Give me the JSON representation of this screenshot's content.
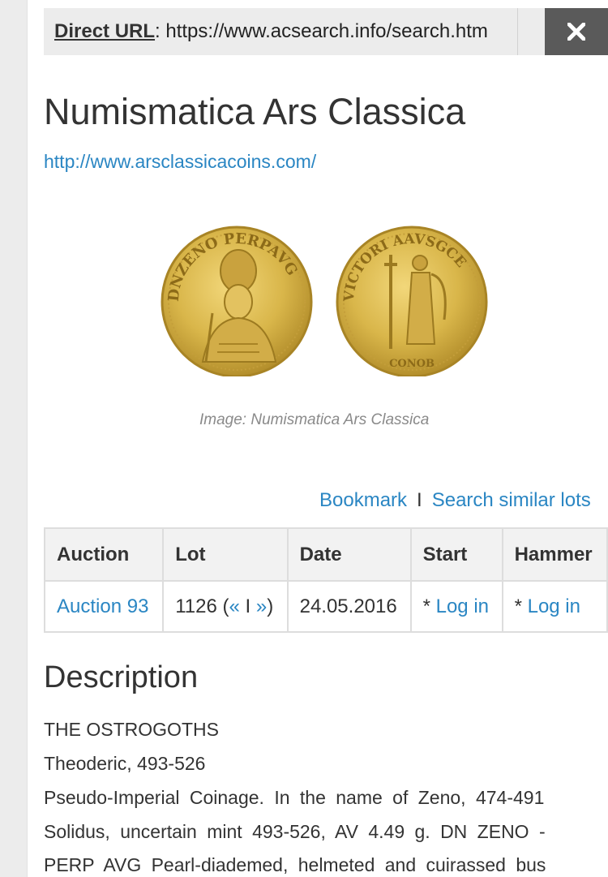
{
  "url_bar": {
    "label": "Direct URL",
    "separator": ":",
    "url": "https://www.acsearch.info/search.htm"
  },
  "close_icon": "close-icon",
  "house": {
    "title": "Numismatica Ars Classica",
    "website": "http://www.arsclassicacoins.com/"
  },
  "image": {
    "obverse_legend": "DNZENO PERPAVG",
    "reverse_legend": "VICTORI AAVSGCE",
    "exergue": "CONOB",
    "caption": "Image: Numismatica Ars Classica"
  },
  "actions": {
    "bookmark": "Bookmark",
    "divider": "I",
    "search_similar": "Search similar lots"
  },
  "table": {
    "headers": [
      "Auction",
      "Lot",
      "Date",
      "Start",
      "Hammer"
    ],
    "row": {
      "auction": "Auction 93",
      "lot_number": "1126",
      "lot_open": "(",
      "prev": "«",
      "nav_divider": "I",
      "next": "»",
      "lot_close": ")",
      "date": "24.05.2016",
      "start_prefix": "* ",
      "start_link": "Log in",
      "hammer_prefix": "* ",
      "hammer_link": "Log in"
    }
  },
  "description": {
    "heading": "Description",
    "lines": [
      "THE OSTROGOTHS",
      "Theoderic, 493-526",
      "Pseudo-Imperial Coinage. In the name of Zeno, 474-491",
      "Solidus, uncertain mint 493-526, AV 4.49 g. DN ZENO -",
      "PERP AVG Pearl-diademed, helmeted and cuirassed bus"
    ]
  },
  "colors": {
    "link": "#2a86c3",
    "text": "#333333",
    "url_bar_bg": "#ececec",
    "close_bg": "#5a5a5a",
    "gold": "#d9b64a"
  }
}
